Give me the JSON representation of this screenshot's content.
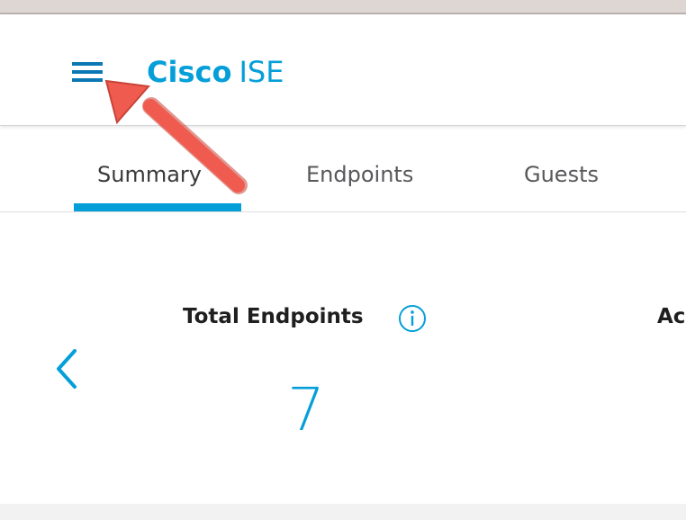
{
  "header": {
    "brand_name": "Cisco",
    "product_name": "ISE",
    "menu_icon": "hamburger-menu-icon",
    "accent_color": "#049fd9"
  },
  "tabs": [
    {
      "label": "Summary",
      "active": true
    },
    {
      "label": "Endpoints",
      "active": false
    },
    {
      "label": "Guests",
      "active": false
    }
  ],
  "summary": {
    "metrics": [
      {
        "title": "Total Endpoints",
        "value": "7",
        "info_icon": "info-icon"
      },
      {
        "title": "Ac"
      }
    ],
    "previous_icon": "chevron-left-icon"
  },
  "annotation": {
    "type": "arrow",
    "color": "#f05b4f",
    "target": "menu-button"
  }
}
